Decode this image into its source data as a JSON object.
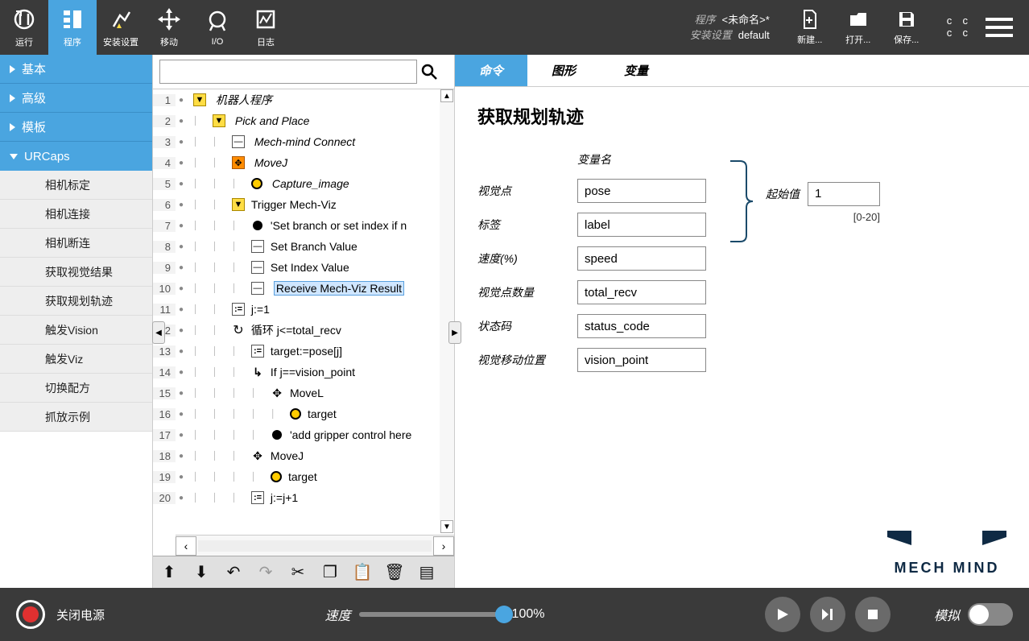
{
  "top_nav": {
    "run": "运行",
    "program": "程序",
    "install": "安装设置",
    "move": "移动",
    "io": "I/O",
    "log": "日志"
  },
  "top_info": {
    "program_lbl": "程序",
    "program_val": "<未命名>*",
    "install_lbl": "安装设置",
    "install_val": "default"
  },
  "top_actions": {
    "new": "新建...",
    "open": "打开...",
    "save": "保存..."
  },
  "cc_badge": "c c\nc c",
  "left": {
    "basic": "基本",
    "advanced": "高级",
    "template": "模板",
    "urcaps": "URCaps",
    "subs": [
      "相机标定",
      "相机连接",
      "相机断连",
      "获取视觉结果",
      "获取规划轨迹",
      "触发Vision",
      "触发Viz",
      "切换配方",
      "抓放示例"
    ]
  },
  "search_placeholder": "",
  "tree": [
    {
      "ln": 1,
      "indent": 0,
      "icon": "yellow-tri",
      "text": "机器人程序",
      "italic": true
    },
    {
      "ln": 2,
      "indent": 1,
      "icon": "yellow-tri",
      "text": "Pick and Place",
      "italic": true
    },
    {
      "ln": 3,
      "indent": 2,
      "icon": "white-box",
      "text": "Mech-mind Connect",
      "italic": true
    },
    {
      "ln": 4,
      "indent": 2,
      "icon": "orange-box",
      "text": "MoveJ",
      "italic": true,
      "move": true
    },
    {
      "ln": 5,
      "indent": 3,
      "icon": "target",
      "text": "Capture_image",
      "italic": true
    },
    {
      "ln": 6,
      "indent": 2,
      "icon": "yellow-tri",
      "text": "Trigger Mech-Viz"
    },
    {
      "ln": 7,
      "indent": 3,
      "icon": "black-dot",
      "text": "'Set branch or set index if n"
    },
    {
      "ln": 8,
      "indent": 3,
      "icon": "white-box",
      "text": "Set Branch Value"
    },
    {
      "ln": 9,
      "indent": 3,
      "icon": "white-box",
      "text": "Set Index Value"
    },
    {
      "ln": 10,
      "indent": 3,
      "icon": "white-box",
      "text": "Receive Mech-Viz Result",
      "selected": true
    },
    {
      "ln": 11,
      "indent": 2,
      "icon": "assign",
      "text": "j:=1"
    },
    {
      "ln": 12,
      "indent": 2,
      "icon": "loop",
      "text": "循环 j<=total_recv"
    },
    {
      "ln": 13,
      "indent": 3,
      "icon": "assign",
      "text": "target:=pose[j]"
    },
    {
      "ln": 14,
      "indent": 3,
      "icon": "if",
      "text": "If j==vision_point"
    },
    {
      "ln": 15,
      "indent": 4,
      "icon": "move",
      "text": "MoveL"
    },
    {
      "ln": 16,
      "indent": 5,
      "icon": "target",
      "text": "target"
    },
    {
      "ln": 17,
      "indent": 4,
      "icon": "black-dot",
      "text": "'add gripper control here"
    },
    {
      "ln": 18,
      "indent": 3,
      "icon": "move",
      "text": "MoveJ"
    },
    {
      "ln": 19,
      "indent": 4,
      "icon": "target",
      "text": "target"
    },
    {
      "ln": 20,
      "indent": 3,
      "icon": "assign",
      "text": "j:=j+1"
    }
  ],
  "tabs": {
    "cmd": "命令",
    "graph": "图形",
    "var": "变量"
  },
  "panel": {
    "title": "获取规划轨迹",
    "var_header": "变量名",
    "rows": [
      {
        "label": "视觉点",
        "value": "pose"
      },
      {
        "label": "标签",
        "value": "label"
      },
      {
        "label": "速度(%)",
        "value": "speed"
      },
      {
        "label": "视觉点数量",
        "value": "total_recv"
      },
      {
        "label": "状态码",
        "value": "status_code"
      },
      {
        "label": "视觉移动位置",
        "value": "vision_point"
      }
    ],
    "start_label": "起始值",
    "start_value": "1",
    "start_range": "[0-20]"
  },
  "logo_text": "MECH MIND",
  "footer": {
    "power": "关闭电源",
    "speed_label": "速度",
    "speed_value": "100%",
    "sim": "模拟"
  }
}
